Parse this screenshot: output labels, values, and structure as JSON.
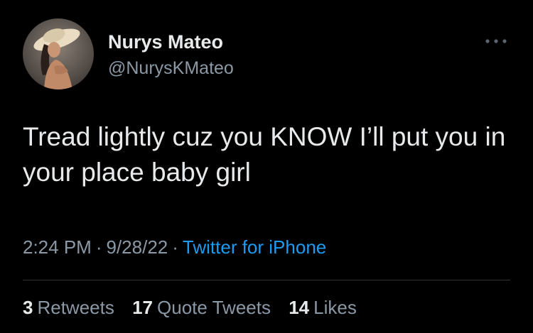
{
  "user": {
    "display_name": "Nurys Mateo",
    "handle": "@NurysKMateo",
    "avatar_icon": "profile-photo"
  },
  "tweet": {
    "text": "Tread lightly cuz you KNOW I’ll put you in your place baby girl",
    "time": "2:24 PM",
    "date": "9/28/22",
    "separator": "·",
    "source": "Twitter for iPhone"
  },
  "stats": {
    "retweets_count": "3",
    "retweets_label": "Retweets",
    "quote_count": "17",
    "quote_label": "Quote Tweets",
    "likes_count": "14",
    "likes_label": "Likes"
  },
  "more_icon": "more-horizontal-icon",
  "colors": {
    "background": "#000000",
    "primary_text": "#e7e9ea",
    "secondary_text": "#8b98a5",
    "link": "#1d9bf0",
    "divider": "#2f3336"
  }
}
